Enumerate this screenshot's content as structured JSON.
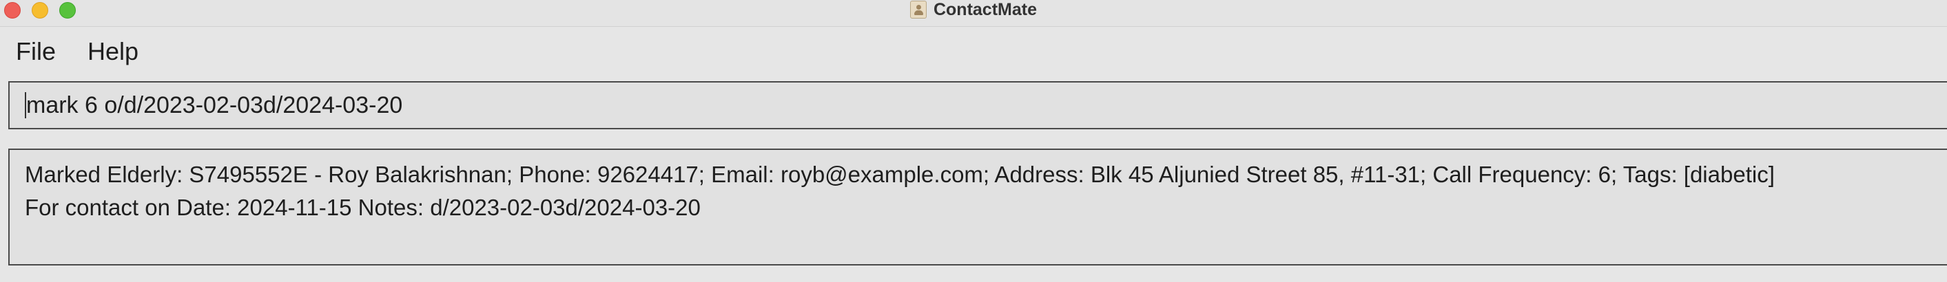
{
  "window": {
    "title": "ContactMate"
  },
  "menu": {
    "items": [
      "File",
      "Help"
    ]
  },
  "command": {
    "value": "mark 6 o/d/2023-02-03d/2024-03-20"
  },
  "result": {
    "lines": [
      "Marked Elderly: S7495552E - Roy Balakrishnan; Phone: 92624417; Email: royb@example.com; Address: Blk 45 Aljunied Street 85, #11-31; Call Frequency: 6; Tags: [diabetic]",
      "For contact on Date: 2024-11-15 Notes: d/2023-02-03d/2024-03-20"
    ]
  },
  "colors": {
    "close": "#ee5f58",
    "minimize": "#f6bd2f",
    "maximize": "#58c23d"
  }
}
